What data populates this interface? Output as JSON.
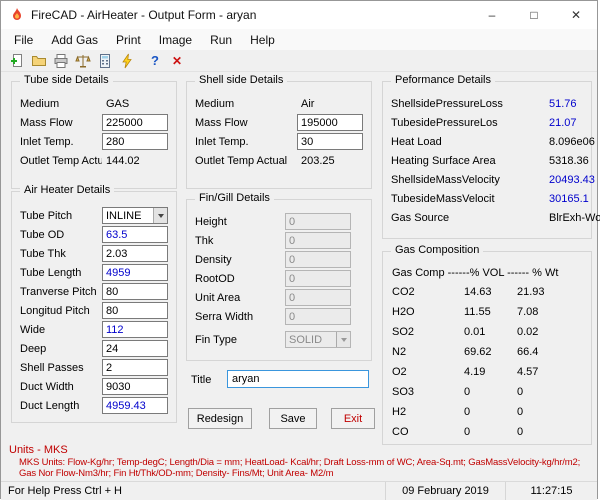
{
  "window": {
    "title": "FireCAD - AirHeater - Output Form - aryan",
    "minimize_glyph": "–",
    "maximize_glyph": "□",
    "close_glyph": "✕"
  },
  "menu": {
    "items": [
      "File",
      "Add Gas",
      "Print",
      "Image",
      "Run",
      "Help"
    ]
  },
  "toolbar": {
    "icons": [
      "new",
      "open",
      "print",
      "scale",
      "calculator",
      "run",
      "help",
      "exit"
    ],
    "help_glyph": "?",
    "exit_glyph": "✕"
  },
  "colors": {
    "value_blue": "#0000cc",
    "alert_red": "#c00000",
    "title_focus_border": "#3a96dd"
  },
  "tube_side": {
    "title": "Tube side Details",
    "medium_label": "Medium",
    "medium_value": "GAS",
    "mass_flow_label": "Mass Flow",
    "mass_flow_value": "225000",
    "inlet_temp_label": "Inlet Temp.",
    "inlet_temp_value": "280",
    "outlet_label": "Outlet Temp Actual",
    "outlet_value": "144.02"
  },
  "shell_side": {
    "title": "Shell side Details",
    "medium_label": "Medium",
    "medium_value": "Air",
    "mass_flow_label": "Mass Flow",
    "mass_flow_value": "195000",
    "inlet_temp_label": "Inlet Temp.",
    "inlet_temp_value": "30",
    "outlet_label": "Outlet Temp Actual",
    "outlet_value": "203.25"
  },
  "performance": {
    "title": "Peformance Details",
    "rows": [
      {
        "label": "ShellsidePressureLoss",
        "value": "51.76"
      },
      {
        "label": "TubesidePressureLos",
        "value": "21.07"
      },
      {
        "label": "Heat Load",
        "value": "8.096e06"
      },
      {
        "label": "Heating Surface Area",
        "value": "5318.36"
      },
      {
        "label": "ShellsideMassVelocity",
        "value": "20493.43"
      },
      {
        "label": "TubesideMassVelocit",
        "value": "30165.1"
      },
      {
        "label": "Gas Source",
        "value": "BlrExh-WoodF"
      }
    ]
  },
  "air_heater": {
    "title": "Air Heater Details",
    "tube_pitch_label": "Tube Pitch",
    "tube_pitch_value": "INLINE",
    "rows": [
      {
        "label": "Tube OD",
        "value": "63.5"
      },
      {
        "label": "Tube Thk",
        "value": "2.03"
      },
      {
        "label": "Tube Length",
        "value": "4959"
      },
      {
        "label": "Tranverse Pitch",
        "value": "80"
      },
      {
        "label": "Longitud Pitch",
        "value": "80"
      },
      {
        "label": "Wide",
        "value": "112"
      },
      {
        "label": "Deep",
        "value": "24"
      },
      {
        "label": "Shell Passes",
        "value": "2"
      },
      {
        "label": "Duct Width",
        "value": "9030"
      },
      {
        "label": "Duct Length",
        "value": "4959.43"
      }
    ]
  },
  "fin_gill": {
    "title": "Fin/Gill Details",
    "rows": [
      {
        "label": "Height",
        "value": "0"
      },
      {
        "label": "Thk",
        "value": "0"
      },
      {
        "label": "Density",
        "value": "0"
      },
      {
        "label": "RootOD",
        "value": "0"
      },
      {
        "label": "Unit Area",
        "value": "0"
      },
      {
        "label": "Serra Width",
        "value": "0"
      }
    ],
    "fin_type_label": "Fin Type",
    "fin_type_value": "SOLID"
  },
  "gas_composition": {
    "title": "Gas Composition",
    "header": "Gas Comp ------% VOL ------ % Wt",
    "rows": [
      {
        "name": "CO2",
        "vol": "14.63",
        "wt": "21.93"
      },
      {
        "name": "H2O",
        "vol": "11.55",
        "wt": "7.08"
      },
      {
        "name": "SO2",
        "vol": "0.01",
        "wt": "0.02"
      },
      {
        "name": "N2",
        "vol": "69.62",
        "wt": "66.4"
      },
      {
        "name": "O2",
        "vol": "4.19",
        "wt": "4.57"
      },
      {
        "name": "SO3",
        "vol": "0",
        "wt": "0"
      },
      {
        "name": "H2",
        "vol": "0",
        "wt": "0"
      },
      {
        "name": "CO",
        "vol": "0",
        "wt": "0"
      }
    ]
  },
  "title_field": {
    "label": "Title",
    "value": "aryan"
  },
  "buttons": {
    "redesign": "Redesign",
    "save": "Save",
    "exit": "Exit"
  },
  "footer": {
    "units": "Units - MKS",
    "line1": "MKS Units: Flow-Kg/hr; Temp-degC; Length/Dia = mm; HeatLoad- Kcal/hr; Draft Loss-mm of WC; Area-Sq.mt; GasMassVelocity-kg/hr/m2;",
    "line2": "Gas Nor Flow-Nm3/hr; Fin Ht/Thk/OD-mm; Density- Fins/Mt; Unit Area- M2/m"
  },
  "status_bar": {
    "help": "For Help Press Ctrl + H",
    "date": "09 February 2019",
    "time": "11:27:15"
  }
}
